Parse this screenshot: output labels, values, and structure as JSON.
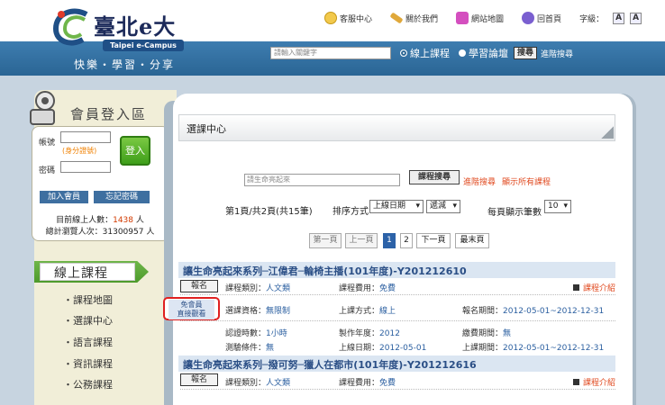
{
  "header": {
    "logo_title": "臺北e大",
    "logo_subtitle": "Taipei e-Campus",
    "slogan": "快樂・學習・分享",
    "links": [
      {
        "label": "客服中心",
        "icon": "smiley-icon"
      },
      {
        "label": "關於我們",
        "icon": "pencil-icon"
      },
      {
        "label": "網站地圖",
        "icon": "map-icon"
      },
      {
        "label": "回首頁",
        "icon": "flower-icon"
      }
    ],
    "font_label": "字級：",
    "font_sizes": [
      "A",
      "A"
    ],
    "search_placeholder": "請輸入關鍵字",
    "radio_online": "線上課程",
    "radio_forum": "學習論壇",
    "search_button": "搜尋",
    "advanced_search": "進階搜尋",
    "colors": {
      "band": "#2a6594",
      "accent_orange": "#e0491f",
      "green": "#4d9a2b"
    }
  },
  "login": {
    "title": "會員登入區",
    "account_label": "帳號",
    "account_hint": "(身分證號)",
    "password_label": "密碼",
    "login_button": "登入",
    "join_button": "加入會員",
    "forgot_button": "忘記密碼",
    "online_prefix": "目前線上人數：",
    "online_count": "1438",
    "online_suffix": " 人",
    "visits_prefix": "總計瀏覽人次：",
    "visits_count": "31300957",
    "visits_suffix": " 人"
  },
  "nav": {
    "title": "線上課程",
    "items": [
      "課程地圖",
      "選課中心",
      "語言課程",
      "資訊課程",
      "公務課程"
    ]
  },
  "main": {
    "title": "選課中心",
    "course_search_placeholder": "請生命亮起來",
    "course_search_button": "課程搜尋",
    "advanced_link": "進階搜尋",
    "show_all_link": "顯示所有課程",
    "page_info": "第1頁/共2頁(共15筆)",
    "sort_label": "排序方式",
    "sort_value": "上線日期",
    "order_value": "遞減",
    "per_page_label": "每頁顯示筆數",
    "per_page_value": "10",
    "pagination": {
      "first": "第一頁",
      "prev": "上一頁",
      "pages": [
        "1",
        "2"
      ],
      "next": "下一頁",
      "last": "最末頁",
      "current": 1
    },
    "courses": [
      {
        "title": "讓生命亮起來系列─江偉君─輪椅主播(101年度)-Y201212610",
        "enroll": "報名",
        "category_label": "課程類別：",
        "category": "人文類",
        "fee_label": "課程費用：",
        "fee": "免費",
        "intro": "課程介紹",
        "free_badge_line1": "免會員",
        "free_badge_line2": "直接觀看",
        "eligibility_label": "選課資格：",
        "eligibility": "無限制",
        "mode_label": "上課方式：",
        "mode": "線上",
        "signup_label": "報名期間：",
        "signup": "2012-05-01~2012-12-31",
        "hours_label": "認證時數：",
        "hours": "1小時",
        "year_label": "製作年度：",
        "year": "2012",
        "payment_label": "繳費期間：",
        "payment": "無",
        "test_label": "測驗條件：",
        "test": "無",
        "online_date_label": "上線日期：",
        "online_date": "2012-05-01",
        "class_period_label": "上課期間：",
        "class_period": "2012-05-01~2012-12-31"
      },
      {
        "title": "讓生命亮起來系列─撥可努─獵人在都市(101年度)-Y201212616",
        "enroll": "報名",
        "category_label": "課程類別：",
        "category": "人文類",
        "fee_label": "課程費用：",
        "fee": "免費",
        "intro": "課程介紹"
      }
    ]
  }
}
